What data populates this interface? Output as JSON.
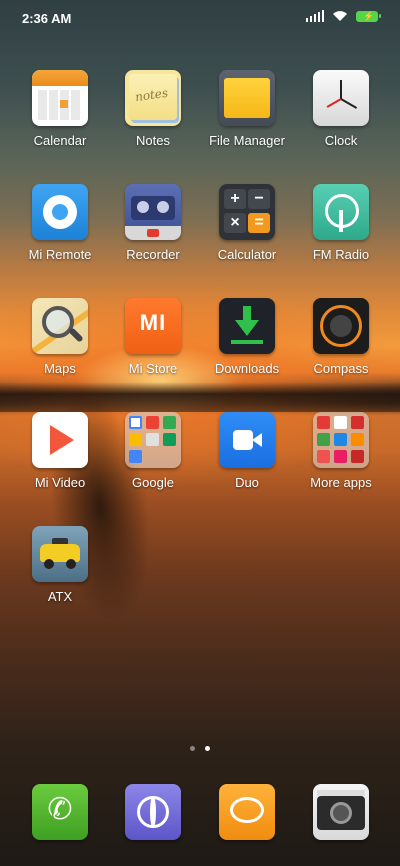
{
  "status_bar": {
    "time": "2:36 AM"
  },
  "apps": [
    {
      "label": "Calendar"
    },
    {
      "label": "Notes",
      "icon_text": "notes"
    },
    {
      "label": "File Manager"
    },
    {
      "label": "Clock"
    },
    {
      "label": "Mi Remote"
    },
    {
      "label": "Recorder"
    },
    {
      "label": "Calculator",
      "keys": [
        "+",
        "−",
        "×",
        "="
      ]
    },
    {
      "label": "FM Radio"
    },
    {
      "label": "Maps"
    },
    {
      "label": "Mi Store",
      "icon_text": "MI"
    },
    {
      "label": "Downloads"
    },
    {
      "label": "Compass"
    },
    {
      "label": "Mi Video"
    },
    {
      "label": "Google"
    },
    {
      "label": "Duo"
    },
    {
      "label": "More apps"
    },
    {
      "label": "ATX"
    }
  ],
  "page_indicator": {
    "count": 2,
    "active": 2
  },
  "dock": [
    {
      "icon": "phone-icon"
    },
    {
      "icon": "browser-icon"
    },
    {
      "icon": "messaging-icon"
    },
    {
      "icon": "camera-icon"
    }
  ],
  "colors": {
    "battery": "#54d54a",
    "sunset": "#f39a3c"
  }
}
